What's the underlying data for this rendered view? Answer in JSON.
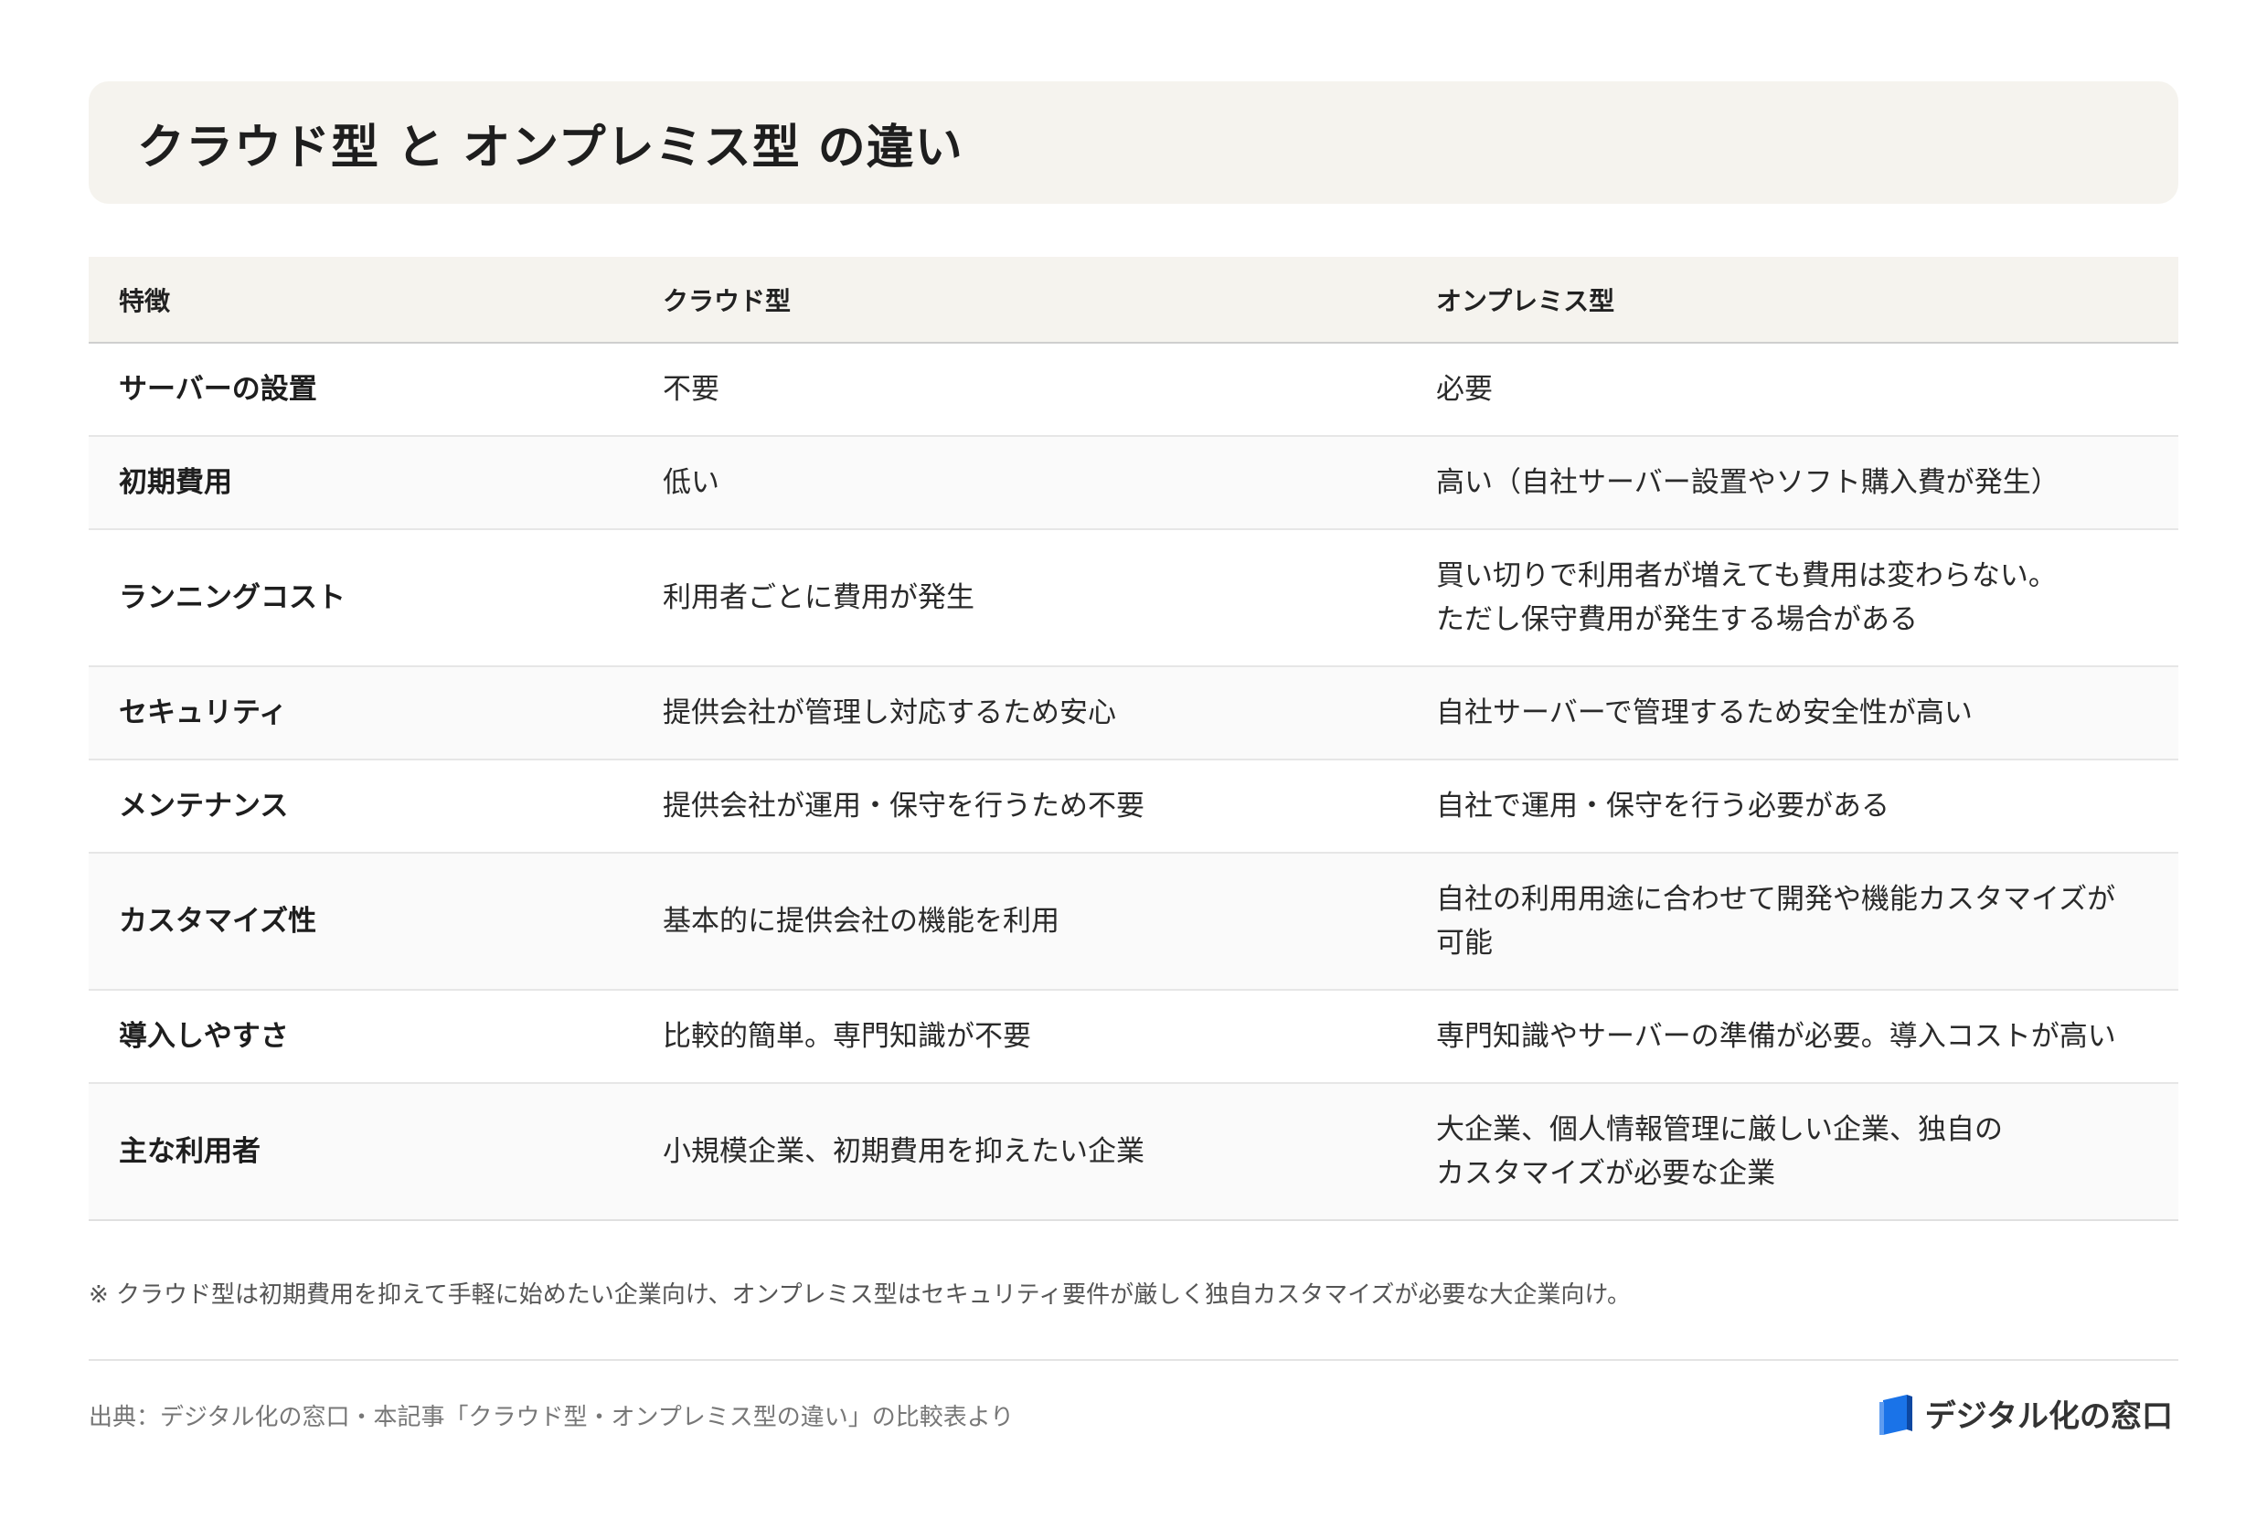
{
  "title": "クラウド型 と オンプレミス型 の違い",
  "table": {
    "headers": [
      "特徴",
      "クラウド型",
      "オンプレミス型"
    ],
    "rows": [
      {
        "feature": "サーバーの設置",
        "cloud": "不要",
        "onprem": "必要"
      },
      {
        "feature": "初期費用",
        "cloud": "低い",
        "onprem": "高い（自社サーバー設置やソフト購入費が発生）"
      },
      {
        "feature": "ランニングコスト",
        "cloud": "利用者ごとに費用が発生",
        "onprem": "買い切りで利用者が増えても費用は変わらない。\nただし保守費用が発生する場合がある"
      },
      {
        "feature": "セキュリティ",
        "cloud": "提供会社が管理し対応するため安心",
        "onprem": "自社サーバーで管理するため安全性が高い"
      },
      {
        "feature": "メンテナンス",
        "cloud": "提供会社が運用・保守を行うため不要",
        "onprem": "自社で運用・保守を行う必要がある"
      },
      {
        "feature": "カスタマイズ性",
        "cloud": "基本的に提供会社の機能を利用",
        "onprem": "自社の利用用途に合わせて開発や機能カスタマイズが\n可能"
      },
      {
        "feature": "導入しやすさ",
        "cloud": "比較的簡単。専門知識が不要",
        "onprem": "専門知識やサーバーの準備が必要。導入コストが高い"
      },
      {
        "feature": "主な利用者",
        "cloud": "小規模企業、初期費用を抑えたい企業",
        "onprem": "大企業、個人情報管理に厳しい企業、独自の\nカスタマイズが必要な企業"
      }
    ]
  },
  "note": "※ クラウド型は初期費用を抑えて手軽に始めたい企業向け、オンプレミス型はセキュリティ要件が厳しく独自カスタマイズが必要な大企業向け。",
  "source": "出典：デジタル化の窓口・本記事「クラウド型・オンプレミス型の違い」の比較表より",
  "brand": {
    "name": "デジタル化の窓口",
    "logo_icon": "blue-book-icon",
    "accent": "#1a73e8"
  }
}
